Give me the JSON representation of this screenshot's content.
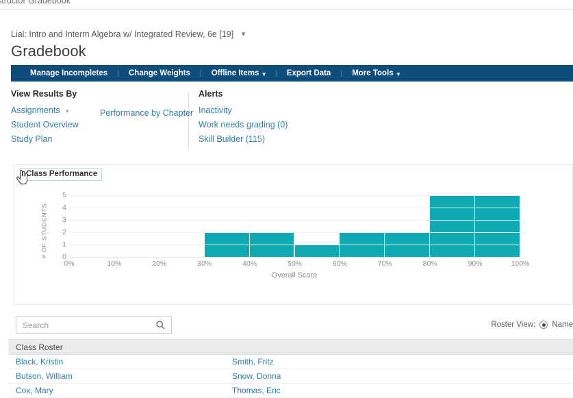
{
  "browser": {
    "tab_title": "structor Gradebook"
  },
  "course": {
    "name": "Lial: Intro and Interm Algebra w/ Integrated Review, 6e [19]",
    "caret": "chevron-down"
  },
  "page_title": "Gradebook",
  "nav": {
    "items": [
      {
        "label": "Manage Incompletes",
        "has_caret": false
      },
      {
        "label": "Change Weights",
        "has_caret": false
      },
      {
        "label": "Offline Items",
        "has_caret": true
      },
      {
        "label": "Export Data",
        "has_caret": false
      },
      {
        "label": "More Tools",
        "has_caret": true
      }
    ],
    "separator": "|"
  },
  "view_results": {
    "heading": "View Results By",
    "links": [
      {
        "label": "Assignments",
        "has_caret": true
      },
      {
        "label": "Student Overview",
        "has_caret": false
      },
      {
        "label": "Study Plan",
        "has_caret": false
      }
    ],
    "secondary_link": "Performance by Chapter"
  },
  "alerts": {
    "heading": "Alerts",
    "links": [
      {
        "label": "Inactivity"
      },
      {
        "label": "Work needs grading (0)"
      },
      {
        "label": "Skill Builder (115)"
      }
    ]
  },
  "chart_card": {
    "tab_label": "Class Performance"
  },
  "chart_data": {
    "type": "bar",
    "title": "Class Performance",
    "xlabel": "Overall Score",
    "ylabel": "# OF STUDENTS",
    "categories": [
      "0%",
      "10%",
      "20%",
      "30%",
      "40%",
      "50%",
      "60%",
      "70%",
      "80%",
      "90%"
    ],
    "xticklabels": [
      "0%",
      "10%",
      "20%",
      "30%",
      "40%",
      "50%",
      "60%",
      "70%",
      "80%",
      "90%",
      "100%"
    ],
    "yticklabels": [
      "0",
      "1",
      "2",
      "3",
      "4",
      "5"
    ],
    "values": [
      0,
      0,
      0,
      2,
      2,
      1,
      2,
      2,
      5,
      5
    ],
    "ylim": [
      0,
      5
    ],
    "xlim": [
      0,
      100
    ],
    "grid": true,
    "legend": "none",
    "bar_color": "#0daab3"
  },
  "search": {
    "placeholder": "Search",
    "value": "",
    "icon": "search-icon"
  },
  "roster_view": {
    "label": "Roster View:",
    "selected_option": "Name"
  },
  "roster": {
    "header": "Class Roster",
    "rows": [
      {
        "left": "Black, Kristin",
        "right": "Smith, Fritz"
      },
      {
        "left": "Butson, William",
        "right": "Snow, Donna"
      },
      {
        "left": "Cox, Mary",
        "right": "Thomas, Eric"
      }
    ]
  },
  "colors": {
    "nav_bar": "#0f4d7d",
    "link": "#2f7ea8",
    "bar_teal": "#0daab3",
    "roster_header_bg": "#ececec"
  }
}
